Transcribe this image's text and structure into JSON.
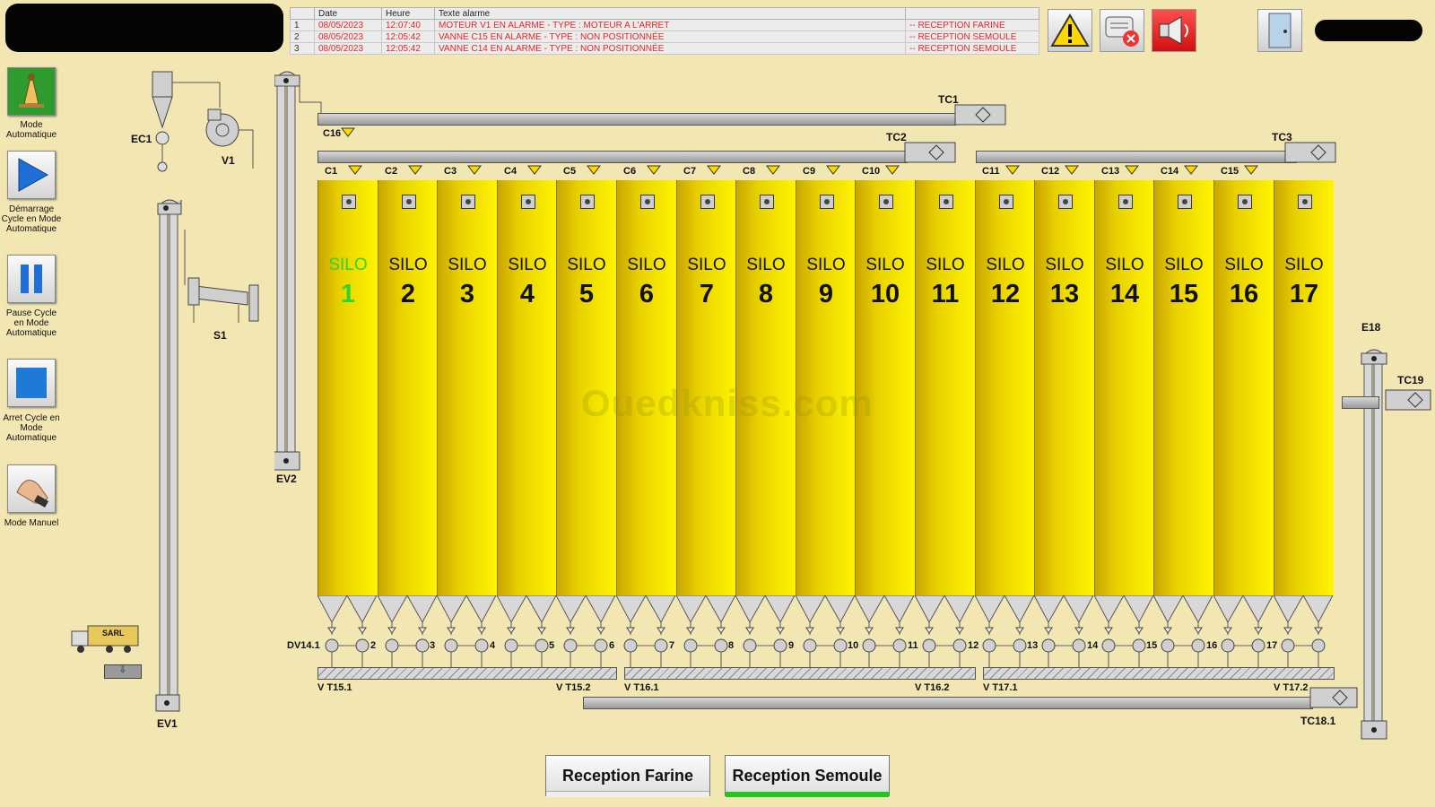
{
  "sidebar": {
    "items": [
      {
        "label": "Mode Automatique",
        "icon": "cone-hand-icon"
      },
      {
        "label": "Démarrage Cycle en Mode Automatique",
        "icon": "play-icon"
      },
      {
        "label": "Pause Cycle en Mode Automatique",
        "icon": "pause-icon"
      },
      {
        "label": "Arret Cycle en Mode Automatique",
        "icon": "stop-icon"
      },
      {
        "label": "Mode Manuel",
        "icon": "hand-icon"
      }
    ]
  },
  "alarms": {
    "headers": [
      "",
      "Date",
      "Heure",
      "Texte alarme",
      ""
    ],
    "rows": [
      {
        "n": "1",
        "date": "08/05/2023",
        "time": "12:07:40",
        "text": "MOTEUR V1 EN ALARME - TYPE : MOTEUR A L'ARRET",
        "source": "-- RECEPTION FARINE"
      },
      {
        "n": "2",
        "date": "08/05/2023",
        "time": "12:05:42",
        "text": "VANNE C15 EN ALARME - TYPE : NON POSITIONNÉE",
        "source": "-- RECEPTION SEMOULE"
      },
      {
        "n": "3",
        "date": "08/05/2023",
        "time": "12:05:42",
        "text": "VANNE C14 EN ALARME - TYPE : NON POSITIONNÉE",
        "source": "-- RECEPTION SEMOULE"
      }
    ]
  },
  "equipment": {
    "ec1": "EC1",
    "v1": "V1",
    "s1": "S1",
    "ev1": "EV1",
    "ev2": "EV2",
    "e18": "E18",
    "tc1": "TC1",
    "tc2": "TC2",
    "tc3": "TC3",
    "tc19": "TC19",
    "tc18": "TC18.1",
    "c16": "C16",
    "dv": "DV14.1",
    "vt151": "V T15.1",
    "vt152": "V T15.2",
    "vt161": "V T16.1",
    "vt162": "V T16.2",
    "vt171": "V T17.1",
    "vt172": "V T17.2",
    "truck": "SARL"
  },
  "silos": {
    "word": "SILO",
    "active_color": "#2bd62b",
    "items": [
      {
        "valve": "C1",
        "num": "1",
        "dv": "",
        "active": true
      },
      {
        "valve": "C2",
        "num": "2",
        "dv": "2"
      },
      {
        "valve": "C3",
        "num": "3",
        "dv": "3"
      },
      {
        "valve": "C4",
        "num": "4",
        "dv": "4"
      },
      {
        "valve": "C5",
        "num": "5",
        "dv": "5"
      },
      {
        "valve": "C6",
        "num": "6",
        "dv": "6"
      },
      {
        "valve": "C7",
        "num": "7",
        "dv": "7"
      },
      {
        "valve": "C8",
        "num": "8",
        "dv": "8"
      },
      {
        "valve": "C9",
        "num": "9",
        "dv": "9"
      },
      {
        "valve": "C10",
        "num": "10",
        "dv": "10"
      },
      {
        "valve": "",
        "num": "11",
        "dv": "11"
      },
      {
        "valve": "C11",
        "num": "12",
        "dv": "12"
      },
      {
        "valve": "C12",
        "num": "13",
        "dv": "13"
      },
      {
        "valve": "C13",
        "num": "14",
        "dv": "14"
      },
      {
        "valve": "C14",
        "num": "15",
        "dv": "15"
      },
      {
        "valve": "C15",
        "num": "16",
        "dv": "16"
      },
      {
        "valve": "",
        "num": "17",
        "dv": "17"
      }
    ]
  },
  "buttons": {
    "reception_farine": "Reception Farine",
    "reception_semoule": "Reception Semoule",
    "semoule_indicator_color": "#1ec81e"
  },
  "watermark": "Ouedkniss.com",
  "colors": {
    "background": "#f2e6b3",
    "silo_yellow": "#fff500",
    "alarm_red": "#e32626"
  }
}
